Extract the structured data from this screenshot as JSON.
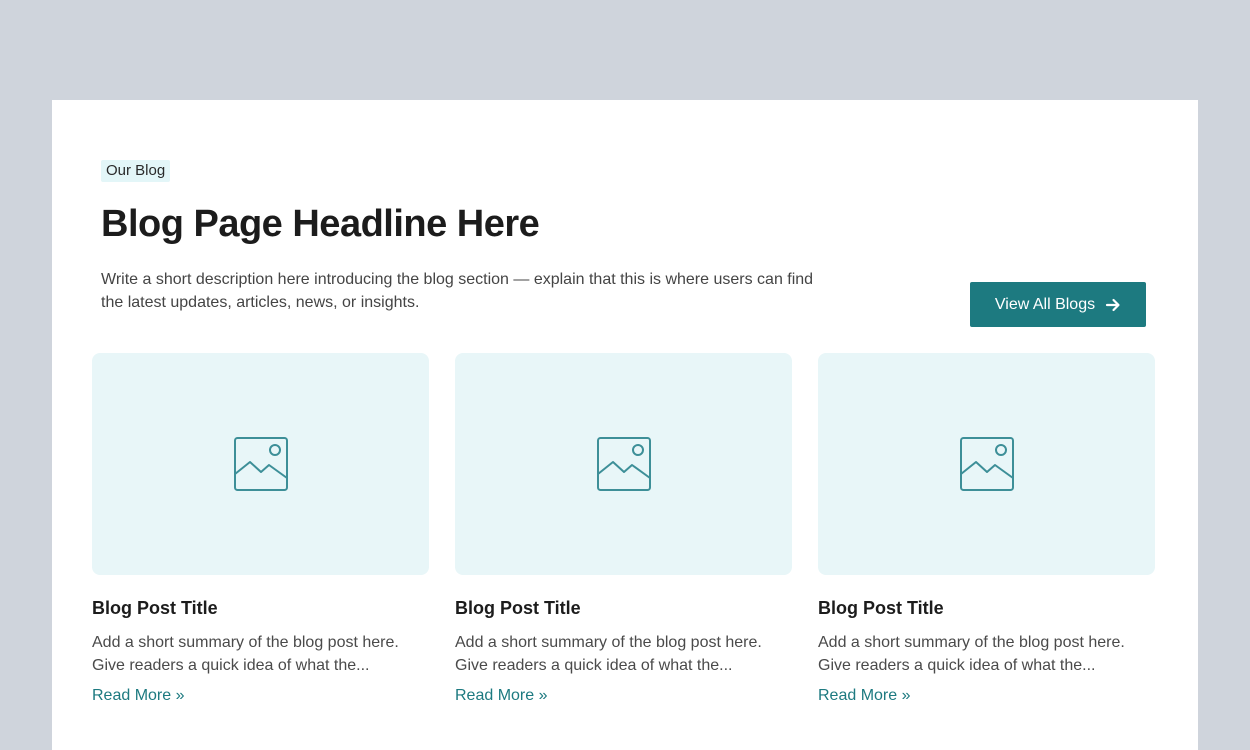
{
  "colors": {
    "page_background": "#cfd4dc",
    "panel_background": "#ffffff",
    "accent": "#1d7a80",
    "eyebrow_background": "#e3f6f8",
    "thumbnail_background": "#e8f6f8",
    "icon_stroke": "#3d8f98"
  },
  "header": {
    "eyebrow": "Our Blog",
    "headline": "Blog Page Headline Here",
    "description": "Write a short description here introducing the blog section — explain that this is where users can find the latest updates, articles, news, or insights.",
    "view_all_label": "View All Blogs",
    "view_all_icon": "arrow-right-icon"
  },
  "posts": [
    {
      "image_icon": "image-placeholder-icon",
      "title": "Blog Post Title",
      "summary": "Add a short summary of the blog post here. Give readers a quick idea of what the...",
      "link_label": "Read More »"
    },
    {
      "image_icon": "image-placeholder-icon",
      "title": "Blog Post Title",
      "summary": "Add a short summary of the blog post here. Give readers a quick idea of what the...",
      "link_label": "Read More »"
    },
    {
      "image_icon": "image-placeholder-icon",
      "title": "Blog Post Title",
      "summary": "Add a short summary of the blog post here. Give readers a quick idea of what the...",
      "link_label": "Read More »"
    }
  ]
}
